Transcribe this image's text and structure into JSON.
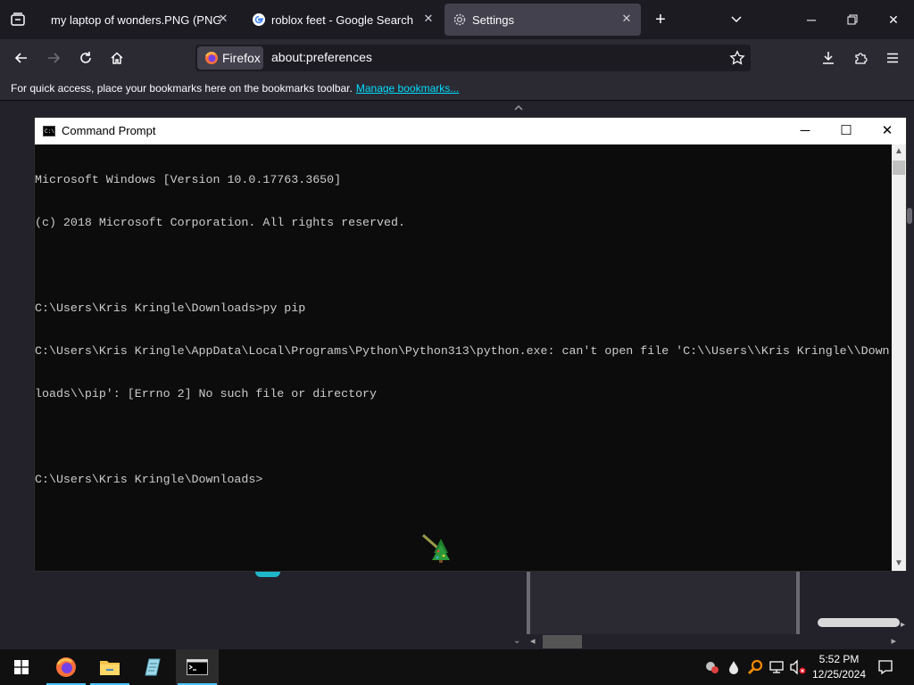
{
  "browser": {
    "tabs": [
      {
        "label": "my laptop of wonders.PNG (PNG Im",
        "selected": false
      },
      {
        "label": "roblox feet - Google Search",
        "selected": false
      },
      {
        "label": "Settings",
        "selected": true
      }
    ],
    "url_identity": "Firefox",
    "url": "about:preferences",
    "bookmarks_message": "For quick access, place your bookmarks here on the bookmarks toolbar.",
    "bookmarks_link": "Manage bookmarks..."
  },
  "cmd": {
    "title": "Command Prompt",
    "lines": [
      "Microsoft Windows [Version 10.0.17763.3650]",
      "(c) 2018 Microsoft Corporation. All rights reserved.",
      "",
      "C:\\Users\\Kris Kringle\\Downloads>py pip",
      "C:\\Users\\Kris Kringle\\AppData\\Local\\Programs\\Python\\Python313\\python.exe: can't open file 'C:\\\\Users\\\\Kris Kringle\\\\Down",
      "loads\\\\pip': [Errno 2] No such file or directory",
      "",
      "C:\\Users\\Kris Kringle\\Downloads>"
    ]
  },
  "taskbar": {
    "time": "5:52 PM",
    "date": "12/25/2024"
  },
  "colors": {
    "accent": "#00ddff",
    "taskbar_indicator": "#4cc2ff",
    "console_bg": "#0c0c0c",
    "console_text": "#cccccc"
  }
}
